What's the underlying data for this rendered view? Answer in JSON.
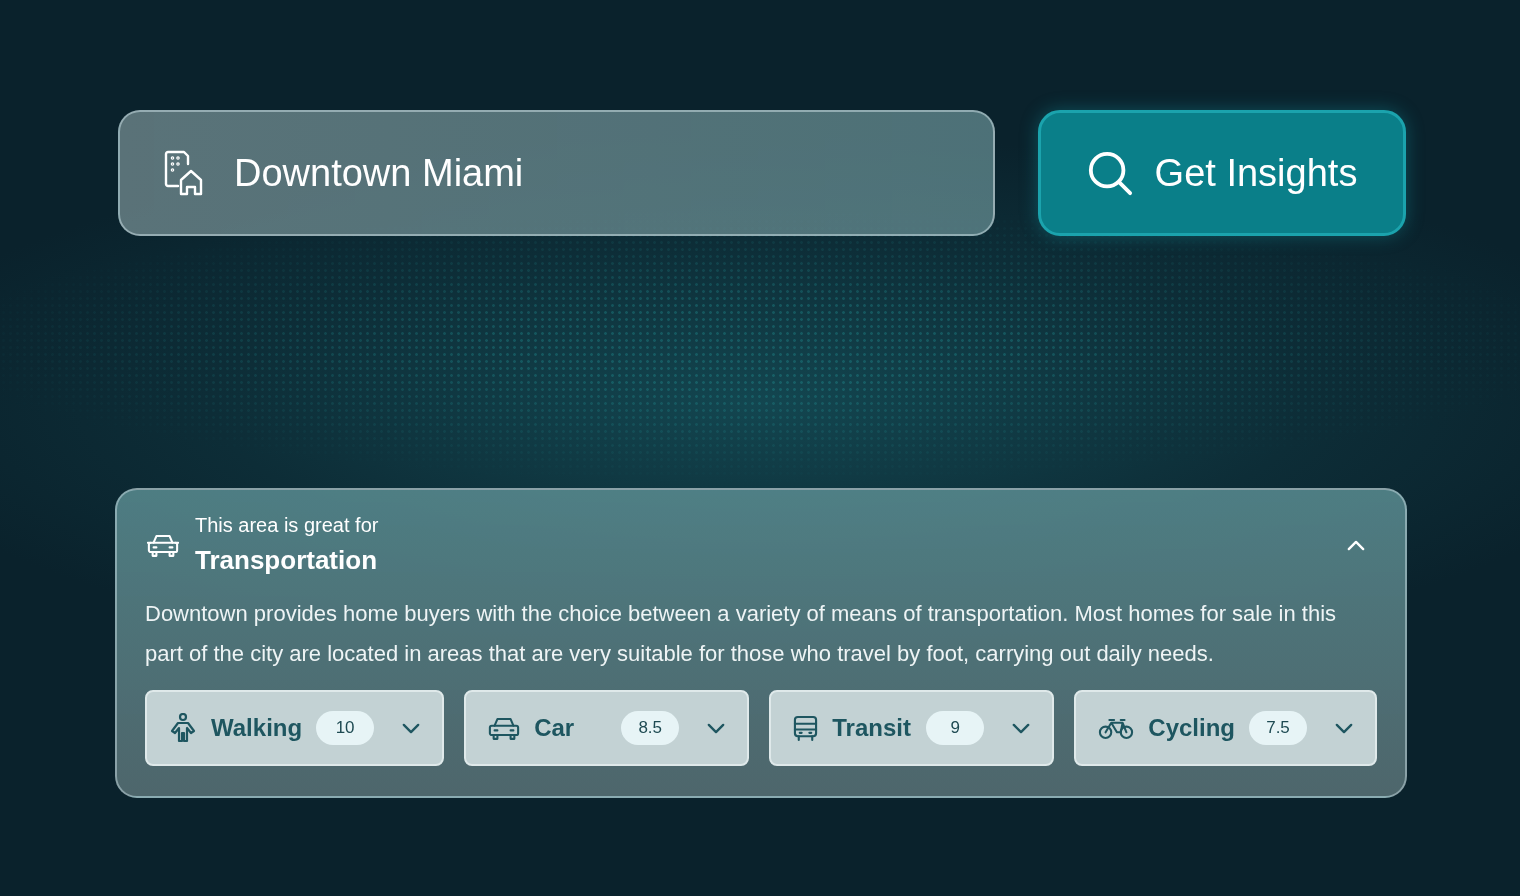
{
  "search": {
    "value": "Downtown Miami"
  },
  "insights_button": {
    "label": "Get Insights"
  },
  "panel": {
    "eyebrow": "This area is great for",
    "title": "Transportation",
    "expanded": true,
    "description": "Downtown provides home buyers with the choice between a variety of means of transportation. Most homes for sale in this part of the city are located in areas that are very suitable for those who travel by foot, carrying out daily needs.",
    "modes": [
      {
        "kind": "walking",
        "label": "Walking",
        "score": "10"
      },
      {
        "kind": "car",
        "label": "Car",
        "score": "8.5"
      },
      {
        "kind": "transit",
        "label": "Transit",
        "score": "9"
      },
      {
        "kind": "cycling",
        "label": "Cycling",
        "score": "7.5"
      }
    ]
  }
}
